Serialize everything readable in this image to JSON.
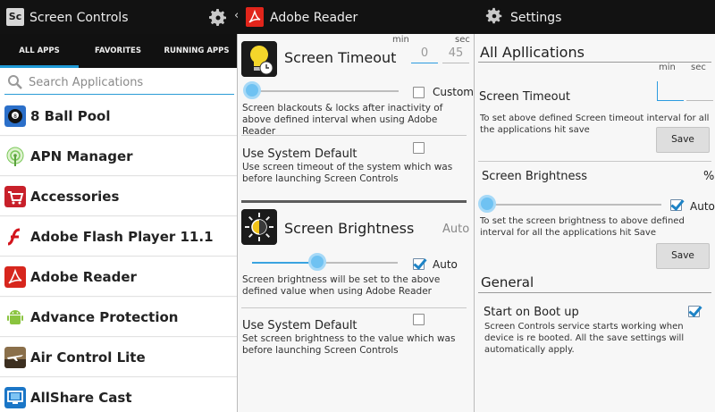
{
  "left": {
    "title": "Screen Controls",
    "logo_text": "Sc",
    "tabs": [
      "ALL APPS",
      "FAVORITES",
      "RUNNING APPS"
    ],
    "search_placeholder": "Search Applications",
    "apps": [
      {
        "name": "8 Ball Pool",
        "icon": "billiard-ball-icon"
      },
      {
        "name": "APN Manager",
        "icon": "antenna-icon"
      },
      {
        "name": "Accessories",
        "icon": "shopping-cart-icon"
      },
      {
        "name": "Adobe Flash Player 11.1",
        "icon": "flash-icon"
      },
      {
        "name": "Adobe Reader",
        "icon": "pdf-icon"
      },
      {
        "name": "Advance Protection",
        "icon": "android-icon"
      },
      {
        "name": "Air Control Lite",
        "icon": "airplane-icon"
      },
      {
        "name": "AllShare Cast",
        "icon": "screen-cast-icon"
      }
    ]
  },
  "middle": {
    "title": "Adobe Reader",
    "timeout": {
      "title": "Screen Timeout",
      "min_label": "min",
      "sec_label": "sec",
      "min_value": "0",
      "sec_value": "45",
      "custom_label": "Custom",
      "custom_checked": false,
      "slider_value": 0,
      "desc": "Screen blackouts & locks after inactivity of above defined interval when using Adobe Reader"
    },
    "timeout_default": {
      "title": "Use System Default",
      "checked": false,
      "desc": "Use screen timeout of the system which was before launching Screen Controls"
    },
    "brightness": {
      "title": "Screen Brightness",
      "value_label": "Auto",
      "auto_label": "Auto",
      "auto_checked": true,
      "slider_value": 0.45,
      "desc": "Screen brightness will be set to the above defined value when using Adobe Reader"
    },
    "brightness_default": {
      "title": "Use System Default",
      "checked": false,
      "desc": "Set screen brightness to the value which was before launching Screen Controls"
    }
  },
  "right": {
    "title": "Settings",
    "all_apps_header": "All Apllications",
    "timeout": {
      "title": "Screen Timeout",
      "min_label": "min",
      "sec_label": "sec",
      "desc": "To set above defined Screen timeout interval for all the applications hit save",
      "save_label": "Save"
    },
    "brightness": {
      "title": "Screen Brightness",
      "unit": "%",
      "auto_label": "Auto",
      "auto_checked": true,
      "slider_value": 0,
      "desc": "To set the screen brightness to above defined interval for all the applications hit Save",
      "save_label": "Save"
    },
    "general_header": "General",
    "boot": {
      "title": "Start on Boot up",
      "checked": true,
      "desc": "Screen Controls service starts working when device is re booted. All the save settings will automatically apply."
    }
  },
  "colors": {
    "accent": "#1f9ad6",
    "topbar": "#121212",
    "pdf_red": "#e1251b"
  }
}
